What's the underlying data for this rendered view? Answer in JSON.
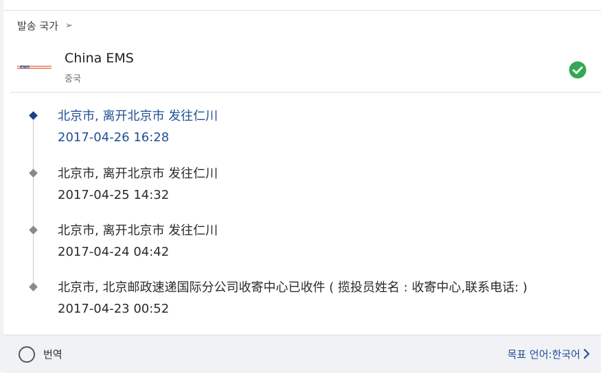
{
  "header": {
    "country_label": "발송 국가",
    "arrow_glyph": "➢"
  },
  "carrier": {
    "logo_text": "EMS",
    "name": "China EMS",
    "country": "중국",
    "status_icon": "check-circle-icon",
    "status_color": "#34a853",
    "brand_color": "#e95b2b"
  },
  "timeline": {
    "events": [
      {
        "desc": "北京市, 离开北京市 发往仁川",
        "time": "2017-04-26 16:28",
        "current": true
      },
      {
        "desc": "北京市, 离开北京市 发往仁川",
        "time": "2017-04-25 14:32",
        "current": false
      },
      {
        "desc": "北京市, 离开北京市 发往仁川",
        "time": "2017-04-24 04:42",
        "current": false
      },
      {
        "desc": "北京市, 北京邮政速递国际分公司收寄中心已收件 ( 揽投员姓名 : 收寄中心,联系电话: )",
        "time": "2017-04-23 00:52",
        "current": false
      }
    ],
    "current_color": "#1f4f96"
  },
  "footer": {
    "translate_label": "번역",
    "target_language": "목표 언어:한국어",
    "chevron_icon": "chevron-right-icon"
  }
}
